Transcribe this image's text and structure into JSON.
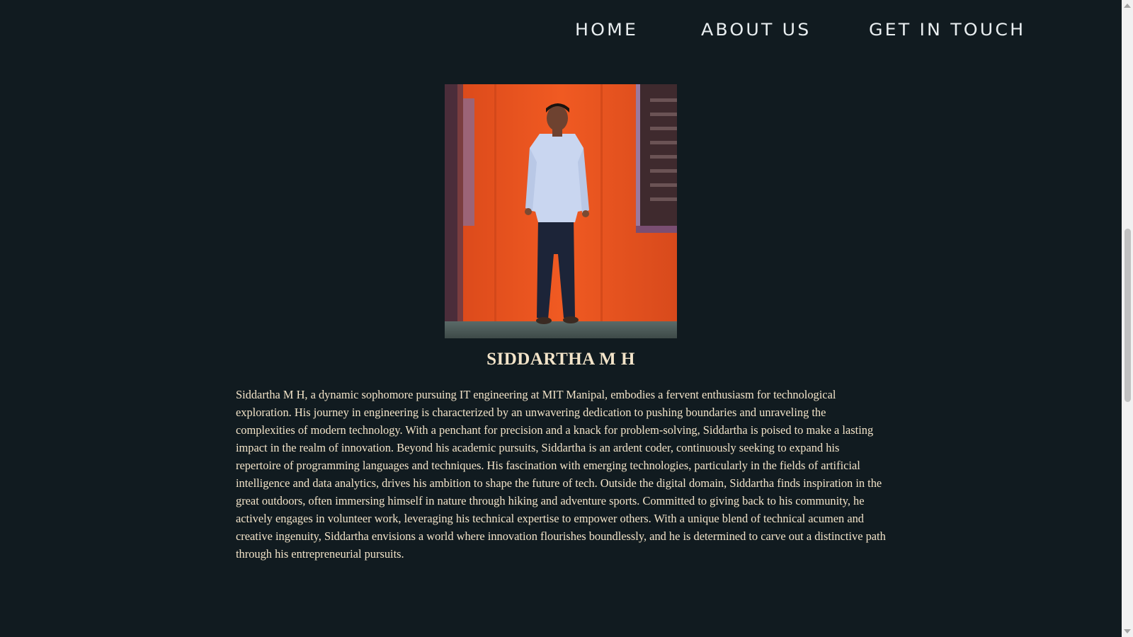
{
  "nav": {
    "home": "Home",
    "about": "About Us",
    "contact": "Get In Touch"
  },
  "profile": {
    "photo_alt": "Portrait of Siddartha M H standing against an orange wall",
    "name": "SIDDARTHA M H",
    "bio": "Siddartha M H, a dynamic sophomore pursuing IT engineering at MIT Manipal, embodies a fervent enthusiasm for technological exploration. His journey in engineering is characterized by an unwavering dedication to pushing boundaries and unraveling the complexities of modern technology. With a penchant for precision and a knack for problem-solving, Siddartha is poised to make a lasting impact in the realm of innovation. Beyond his academic pursuits, Siddartha is an ardent coder, continuously seeking to expand his repertoire of programming languages and techniques. His fascination with emerging technologies, particularly in the fields of artificial intelligence and data analytics, drives his ambition to shape the future of tech. Outside the digital domain, Siddartha finds inspiration in the great outdoors, often immersing himself in nature through hiking and adventure sports. Committed to giving back to his community, he actively engages in volunteer work, leveraging his technical expertise to empower others. With a unique blend of technical acumen and creative ingenuity, Siddartha envisions a world where innovation flourishes boundlessly, and he is determined to carve out a distinctive path through his entrepreneurial pursuits."
  },
  "colors": {
    "background": "#111b20",
    "text": "#f3e4c9",
    "nav_text": "#e9eef0",
    "photo_wall": "#e8541e"
  }
}
